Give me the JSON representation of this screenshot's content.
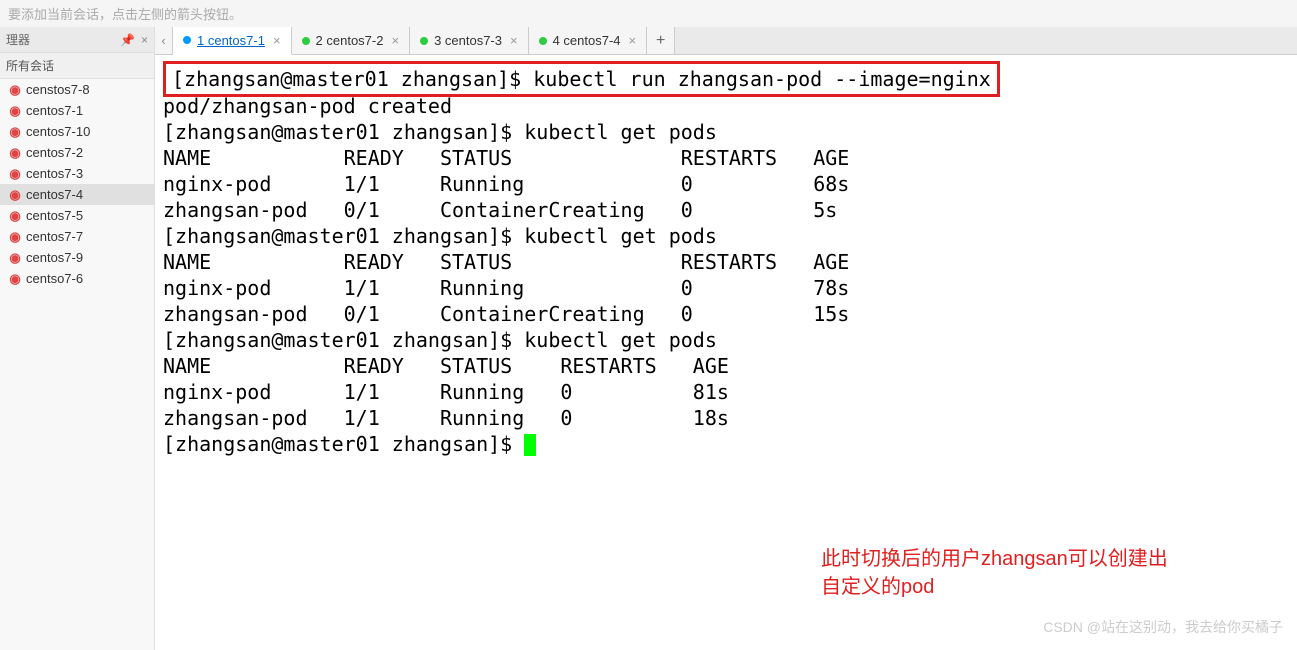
{
  "hint_text": "要添加当前会话，点击左侧的箭头按钮。",
  "sidebar": {
    "manager_label": "理器",
    "all_sessions_label": "所有会话",
    "items": [
      {
        "label": "censtos7-8"
      },
      {
        "label": "centos7-1"
      },
      {
        "label": "centos7-10"
      },
      {
        "label": "centos7-2"
      },
      {
        "label": "centos7-3"
      },
      {
        "label": "centos7-4"
      },
      {
        "label": "centos7-5"
      },
      {
        "label": "centos7-7"
      },
      {
        "label": "centos7-9"
      },
      {
        "label": "centso7-6"
      }
    ],
    "selected_index": 5
  },
  "tabs": [
    {
      "label": "1 centos7-1",
      "active": true
    },
    {
      "label": "2 centos7-2",
      "active": false
    },
    {
      "label": "3 centos7-3",
      "active": false
    },
    {
      "label": "4 centos7-4",
      "active": false
    }
  ],
  "terminal": {
    "highlighted_line": "[zhangsan@master01 zhangsan]$ kubectl run zhangsan-pod --image=nginx",
    "lines": [
      "pod/zhangsan-pod created",
      "[zhangsan@master01 zhangsan]$ kubectl get pods",
      "NAME           READY   STATUS              RESTARTS   AGE",
      "nginx-pod      1/1     Running             0          68s",
      "zhangsan-pod   0/1     ContainerCreating   0          5s",
      "[zhangsan@master01 zhangsan]$ kubectl get pods",
      "NAME           READY   STATUS              RESTARTS   AGE",
      "nginx-pod      1/1     Running             0          78s",
      "zhangsan-pod   0/1     ContainerCreating   0          15s",
      "[zhangsan@master01 zhangsan]$ kubectl get pods",
      "NAME           READY   STATUS    RESTARTS   AGE",
      "nginx-pod      1/1     Running   0          81s",
      "zhangsan-pod   1/1     Running   0          18s"
    ],
    "prompt_last": "[zhangsan@master01 zhangsan]$ "
  },
  "annotation": {
    "line1": "此时切换后的用户zhangsan可以创建出",
    "line2": "自定义的pod"
  },
  "watermark": "CSDN @站在这别动，我去给你买橘子"
}
